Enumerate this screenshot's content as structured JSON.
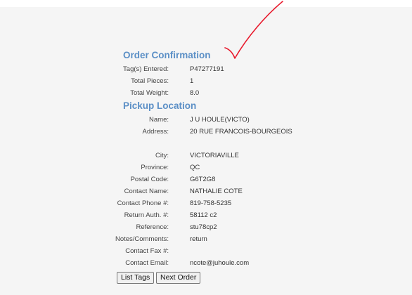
{
  "colors": {
    "heading": "#5b8fc6",
    "checkmark": "#e8192c",
    "background": "#f5f5f5"
  },
  "icons": {
    "annotation": "red-checkmark-icon"
  },
  "order": {
    "title": "Order Confirmation",
    "fields": [
      {
        "label": "Tag(s) Entered:",
        "value": "P47277191"
      },
      {
        "label": "Total Pieces:",
        "value": "1"
      },
      {
        "label": "Total Weight:",
        "value": "8.0"
      }
    ]
  },
  "pickup": {
    "title": "Pickup Location",
    "fields": [
      {
        "label": "Name:",
        "value": "J U HOULE(VICTO)"
      },
      {
        "label": "Address:",
        "value": "20 RUE FRANCOIS-BOURGEOIS"
      },
      {
        "label": "City:",
        "value": "VICTORIAVILLE"
      },
      {
        "label": "Province:",
        "value": "QC"
      },
      {
        "label": "Postal Code:",
        "value": "G6T2G8"
      },
      {
        "label": "Contact Name:",
        "value": "NATHALIE COTE"
      },
      {
        "label": "Contact Phone #:",
        "value": "819-758-5235"
      },
      {
        "label": "Return Auth. #:",
        "value": "58112 c2"
      },
      {
        "label": "Reference:",
        "value": "stu78cp2"
      },
      {
        "label": "Notes/Comments:",
        "value": "return"
      },
      {
        "label": "Contact Fax #:",
        "value": ""
      },
      {
        "label": "Contact Email:",
        "value": "ncote@juhoule.com"
      }
    ]
  },
  "buttons": {
    "list_tags": "List Tags",
    "next_order": "Next Order"
  }
}
